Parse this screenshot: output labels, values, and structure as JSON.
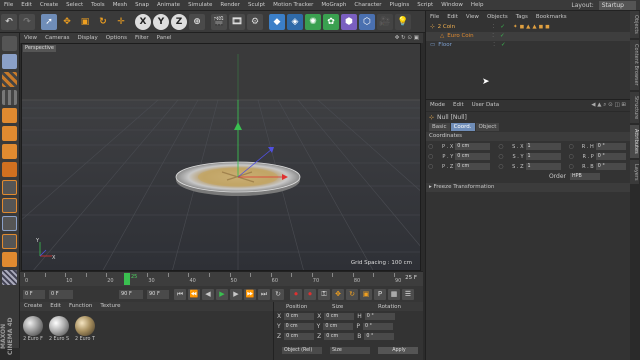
{
  "menubar": {
    "items": [
      "File",
      "Edit",
      "Create",
      "Select",
      "Tools",
      "Mesh",
      "Snap",
      "Animate",
      "Simulate",
      "Render",
      "Sculpt",
      "Motion Tracker",
      "MoGraph",
      "Character",
      "Plugins",
      "Script",
      "Window",
      "Help"
    ],
    "layout_label": "Layout:",
    "layout_value": "Startup"
  },
  "toolbar": {
    "axis_x": "X",
    "axis_y": "Y",
    "axis_z": "Z"
  },
  "viewport": {
    "menu": [
      "View",
      "Cameras",
      "Display",
      "Options",
      "Filter",
      "Panel"
    ],
    "camera_label": "Perspective",
    "grid_spacing": "Grid Spacing : 100 cm"
  },
  "timeline": {
    "ticks": [
      "0",
      "5",
      "10",
      "15",
      "20",
      "25",
      "30",
      "35",
      "40",
      "45",
      "50",
      "55",
      "60",
      "65",
      "70",
      "75",
      "80",
      "85",
      "90"
    ],
    "current_frame": "25",
    "frame_readout": "25 F"
  },
  "transport": {
    "start": "0 F",
    "min": "0 F",
    "max": "90 F",
    "end": "90 F"
  },
  "material_manager": {
    "menu": [
      "Create",
      "Edit",
      "Function",
      "Texture"
    ],
    "materials": [
      {
        "name": "2 Euro F",
        "color": "#9a9a9a"
      },
      {
        "name": "2 Euro S",
        "color": "#b0b0b0"
      },
      {
        "name": "2 Euro T",
        "color": "#a89060"
      }
    ]
  },
  "coordinates_panel": {
    "headers": [
      "Position",
      "Size",
      "Rotation"
    ],
    "rows": [
      {
        "axis": "X",
        "pos": "0 cm",
        "size_axis": "X",
        "size": "0 cm",
        "rot_axis": "H",
        "rot": "0 °"
      },
      {
        "axis": "Y",
        "pos": "0 cm",
        "size_axis": "Y",
        "size": "0 cm",
        "rot_axis": "P",
        "rot": "0 °"
      },
      {
        "axis": "Z",
        "pos": "0 cm",
        "size_axis": "Z",
        "size": "0 cm",
        "rot_axis": "B",
        "rot": "0 °"
      }
    ],
    "mode_select": "Object (Rel)",
    "size_select": "Size",
    "apply_label": "Apply"
  },
  "object_manager": {
    "menu": [
      "File",
      "Edit",
      "View",
      "Objects",
      "Tags",
      "Bookmarks"
    ],
    "objects": [
      {
        "name": "2 Coin",
        "color": "#e0a040"
      },
      {
        "name": "Euro Coin",
        "color": "#e08a30"
      },
      {
        "name": "Floor",
        "color": "#7da0d0"
      }
    ]
  },
  "attribute_manager": {
    "menu": [
      "Mode",
      "Edit",
      "User Data"
    ],
    "object_label": "Null [Null]",
    "tabs": [
      "Basic",
      "Coord.",
      "Object"
    ],
    "active_tab": "Coord.",
    "section": "Coordinates",
    "rows": [
      {
        "p_label": "P . X",
        "p": "0 cm",
        "s_label": "S . X",
        "s": "1",
        "r_label": "R . H",
        "r": "0 °"
      },
      {
        "p_label": "P . Y",
        "p": "0 cm",
        "s_label": "S . Y",
        "s": "1",
        "r_label": "R . P",
        "r": "0 °"
      },
      {
        "p_label": "P . Z",
        "p": "0 cm",
        "s_label": "S . Z",
        "s": "1",
        "r_label": "R . B",
        "r": "0 °"
      }
    ],
    "order_label": "Order",
    "order_value": "HPB",
    "freeze": "Freeze Transformation"
  },
  "side_tabs": [
    "Objects",
    "Content Browser",
    "Structure",
    "Attributes",
    "Layers"
  ],
  "logo": "MAXON CINEMA 4D"
}
